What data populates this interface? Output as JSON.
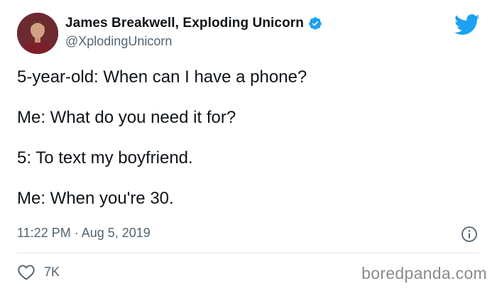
{
  "tweet": {
    "author_name": "James Breakwell, Exploding Unicorn",
    "handle": "@XplodingUnicorn",
    "lines": [
      "5-year-old: When can I have a phone?",
      "Me: What do you need it for?",
      "5: To text my boyfriend.",
      "Me: When you're 30."
    ],
    "timestamp": "11:22 PM · Aug 5, 2019",
    "likes": "7K"
  },
  "watermark": "boredpanda.com",
  "colors": {
    "twitter_blue": "#1da1f2",
    "text": "#0f1419",
    "muted": "#536471"
  },
  "icons": [
    "avatar",
    "verified-badge-icon",
    "twitter-bird-icon",
    "info-icon",
    "heart-icon"
  ]
}
